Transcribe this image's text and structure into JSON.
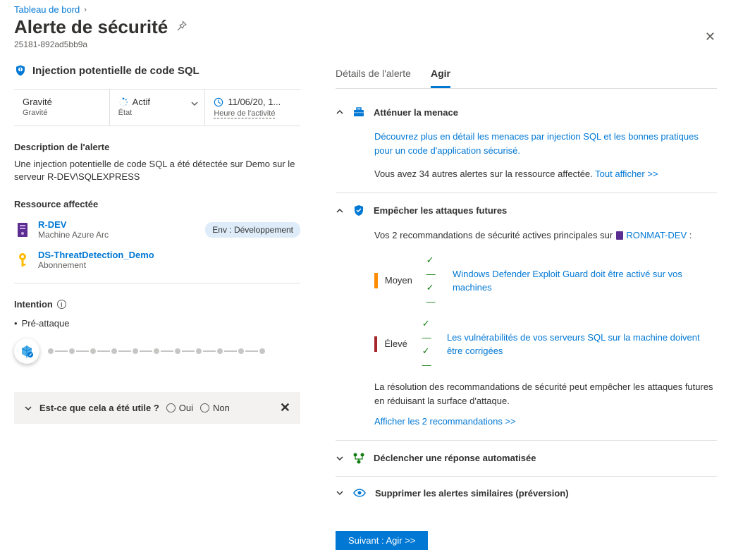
{
  "breadcrumb": {
    "root": "Tableau de bord"
  },
  "page": {
    "title": "Alerte de sécurité",
    "id": "25181-892ad5bb9a"
  },
  "alert": {
    "name": "Injection potentielle de code SQL",
    "severity_label": "Gravité",
    "severity_sub": "Gravité",
    "state_value": "Actif",
    "state_label": "État",
    "time_value": "11/06/20, 1...",
    "time_label": "Heure de l'activité"
  },
  "description": {
    "heading": "Description de l'alerte",
    "text": "Une injection potentielle de code SQL a été détectée sur Demo sur le serveur R-DEV\\SQLEXPRESS"
  },
  "affected": {
    "heading": "Ressource affectée",
    "items": [
      {
        "name": "R-DEV",
        "sub": "Machine Azure Arc",
        "env": "Env : Développement",
        "icon": "server"
      },
      {
        "name": "DS-ThreatDetection_Demo",
        "sub": "Abonnement",
        "icon": "key"
      }
    ]
  },
  "intent": {
    "heading": "Intention",
    "stage": "Pré-attaque"
  },
  "feedback": {
    "question": "Est-ce que cela a été utile ?",
    "yes": "Oui",
    "no": "Non"
  },
  "tabs": {
    "details": "Détails de l'alerte",
    "act": "Agir"
  },
  "sections": {
    "mitigate": {
      "title": "Atténuer la menace",
      "link": "Découvrez plus en détail les menaces par injection SQL et les bonnes pratiques pour un code d'application sécurisé.",
      "more_prefix": "Vous avez 34 autres alertes sur la ressource affectée. ",
      "more_link": "Tout afficher >>"
    },
    "prevent": {
      "title": "Empêcher les attaques futures",
      "intro_prefix": "Vos 2 recommandations de sécurité actives principales sur ",
      "resource": "RONMAT-DEV",
      "intro_suffix": " :",
      "recs": [
        {
          "sev": "Moyen",
          "sev_class": "med",
          "text": "Windows Defender Exploit Guard doit être activé sur vos machines"
        },
        {
          "sev": "Élevé",
          "sev_class": "high",
          "text": "Les vulnérabilités de vos serveurs SQL sur la machine doivent être corrigées"
        }
      ],
      "note": "La résolution des recommandations de sécurité peut empêcher les attaques futures en réduisant la surface d'attaque.",
      "show_link": "Afficher les 2 recommandations  >>"
    },
    "automate": {
      "title": "Déclencher une réponse automatisée"
    },
    "suppress": {
      "title": "Supprimer les alertes similaires (préversion)"
    }
  },
  "button": {
    "next": "Suivant : Agir  >>"
  }
}
